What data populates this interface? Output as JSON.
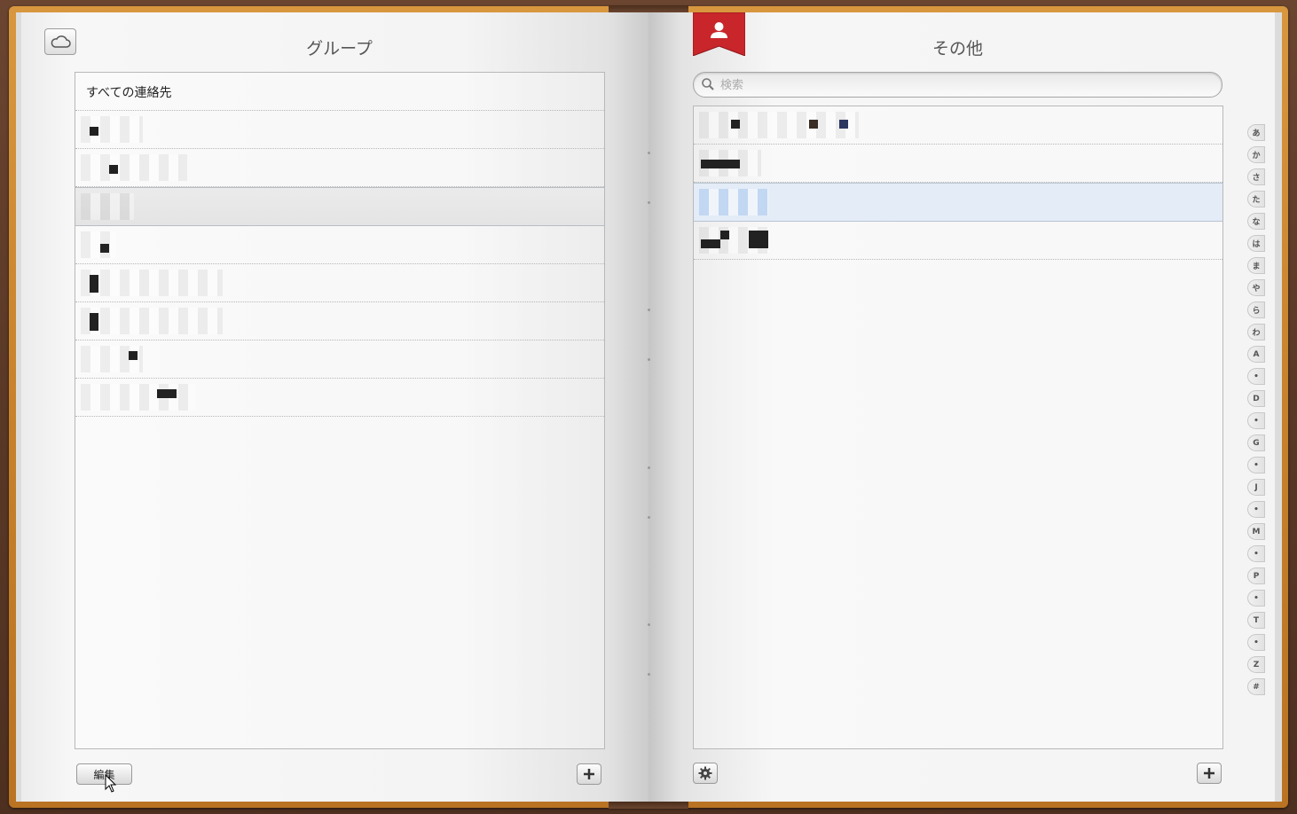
{
  "left_page": {
    "title": "グループ",
    "groups": [
      {
        "label": "すべての連絡先"
      }
    ],
    "edit_label": "編集"
  },
  "right_page": {
    "title": "その他",
    "search": {
      "placeholder": "検索"
    },
    "index": [
      "あ",
      "か",
      "さ",
      "た",
      "な",
      "は",
      "ま",
      "や",
      "ら",
      "わ",
      "A",
      "•",
      "D",
      "•",
      "G",
      "•",
      "J",
      "•",
      "M",
      "•",
      "P",
      "•",
      "T",
      "•",
      "Z",
      "#"
    ]
  },
  "icons": {
    "cloud": "cloud-icon",
    "bookmark": "person-bookmark-icon",
    "search": "search-icon",
    "settings": "gear-icon",
    "add": "plus-icon"
  },
  "colors": {
    "leather": "#5a3a26",
    "page_edge": "#c7822b",
    "bookmark_red": "#c8262b",
    "selected_contact": "#e3ecf7"
  }
}
